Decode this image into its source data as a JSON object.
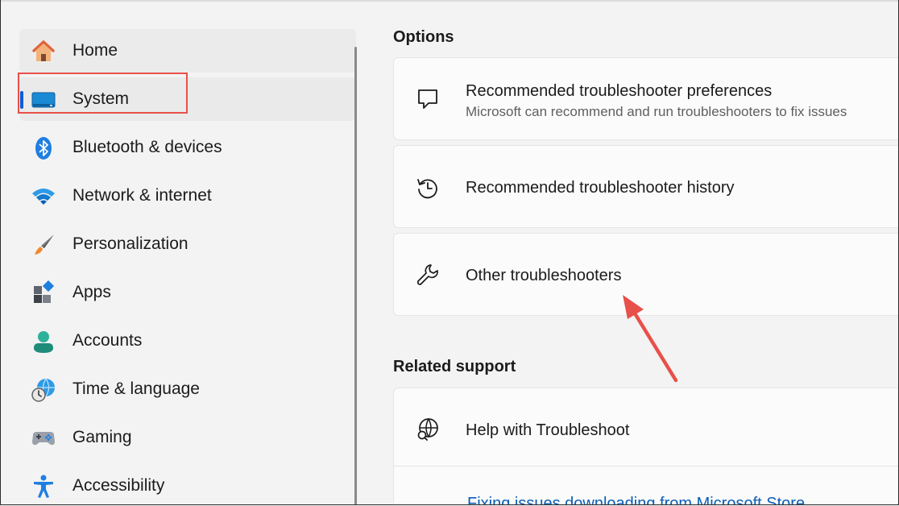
{
  "sidebar": {
    "items": [
      {
        "label": "Home",
        "icon": "home-icon"
      },
      {
        "label": "System",
        "icon": "system-icon"
      },
      {
        "label": "Bluetooth & devices",
        "icon": "bluetooth-icon"
      },
      {
        "label": "Network & internet",
        "icon": "wifi-icon"
      },
      {
        "label": "Personalization",
        "icon": "paintbrush-icon"
      },
      {
        "label": "Apps",
        "icon": "apps-icon"
      },
      {
        "label": "Accounts",
        "icon": "person-icon"
      },
      {
        "label": "Time & language",
        "icon": "globe-clock-icon"
      },
      {
        "label": "Gaming",
        "icon": "gamepad-icon"
      },
      {
        "label": "Accessibility",
        "icon": "accessibility-icon"
      }
    ],
    "selected": "System"
  },
  "options": {
    "title": "Options",
    "cards": [
      {
        "title": "Recommended troubleshooter preferences",
        "subtitle": "Microsoft can recommend and run troubleshooters to fix issues",
        "icon": "chat-bubble-icon"
      },
      {
        "title": "Recommended troubleshooter history",
        "icon": "history-icon"
      },
      {
        "title": "Other troubleshooters",
        "icon": "wrench-icon"
      }
    ]
  },
  "related": {
    "title": "Related support",
    "help_title": "Help with Troubleshoot",
    "help_icon": "globe-search-icon",
    "link": "Fixing issues downloading from Microsoft Store"
  },
  "colors": {
    "accent": "#0b5cd6",
    "annotation": "#e8504a",
    "link": "#0a5db5"
  }
}
